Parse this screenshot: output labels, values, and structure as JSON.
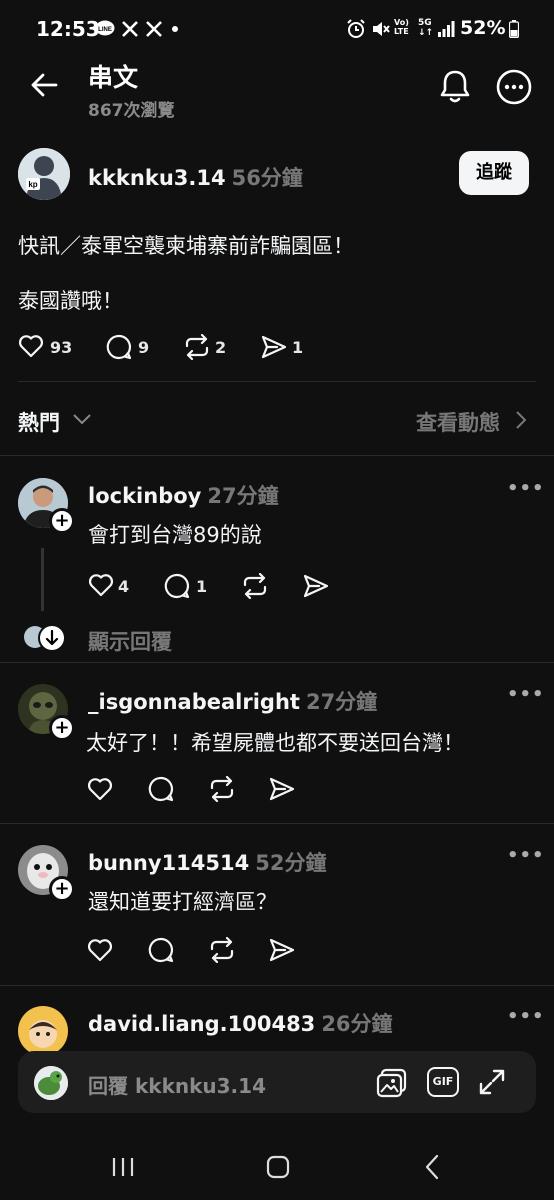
{
  "status_bar": {
    "time": "12:53",
    "battery": "52%",
    "network": "5G",
    "volte": "Vo) LTE"
  },
  "header": {
    "title": "串文",
    "views": "867次瀏覽"
  },
  "post": {
    "username": "kkknku3.14",
    "time": "56分鐘",
    "follow_label": "追蹤",
    "line1": "快訊／泰軍空襲柬埔寨前詐騙園區！",
    "line2": "泰國讚哦！",
    "likes": "93",
    "comments": "9",
    "reposts": "2",
    "shares": "1"
  },
  "filter": {
    "label": "熱門",
    "view_activity": "查看動態"
  },
  "replies": [
    {
      "username": "lockinboy",
      "time": "27分鐘",
      "text": "會打到台灣89的說",
      "likes": "4",
      "comments": "1",
      "show_replies": "顯示回覆"
    },
    {
      "username": "_isgonnabealright",
      "time": "27分鐘",
      "text": "太好了！！希望屍體也都不要送回台灣！"
    },
    {
      "username": "bunny114514",
      "time": "52分鐘",
      "text": "還知道要打經濟區？"
    },
    {
      "username": "david.liang.100483",
      "time": "26分鐘"
    }
  ],
  "reply_bar": {
    "placeholder": "回覆 kkknku3.14",
    "gif_label": "GIF"
  },
  "colors": {
    "background": "#101010",
    "text": "#f3f5f7",
    "muted": "#777777"
  }
}
